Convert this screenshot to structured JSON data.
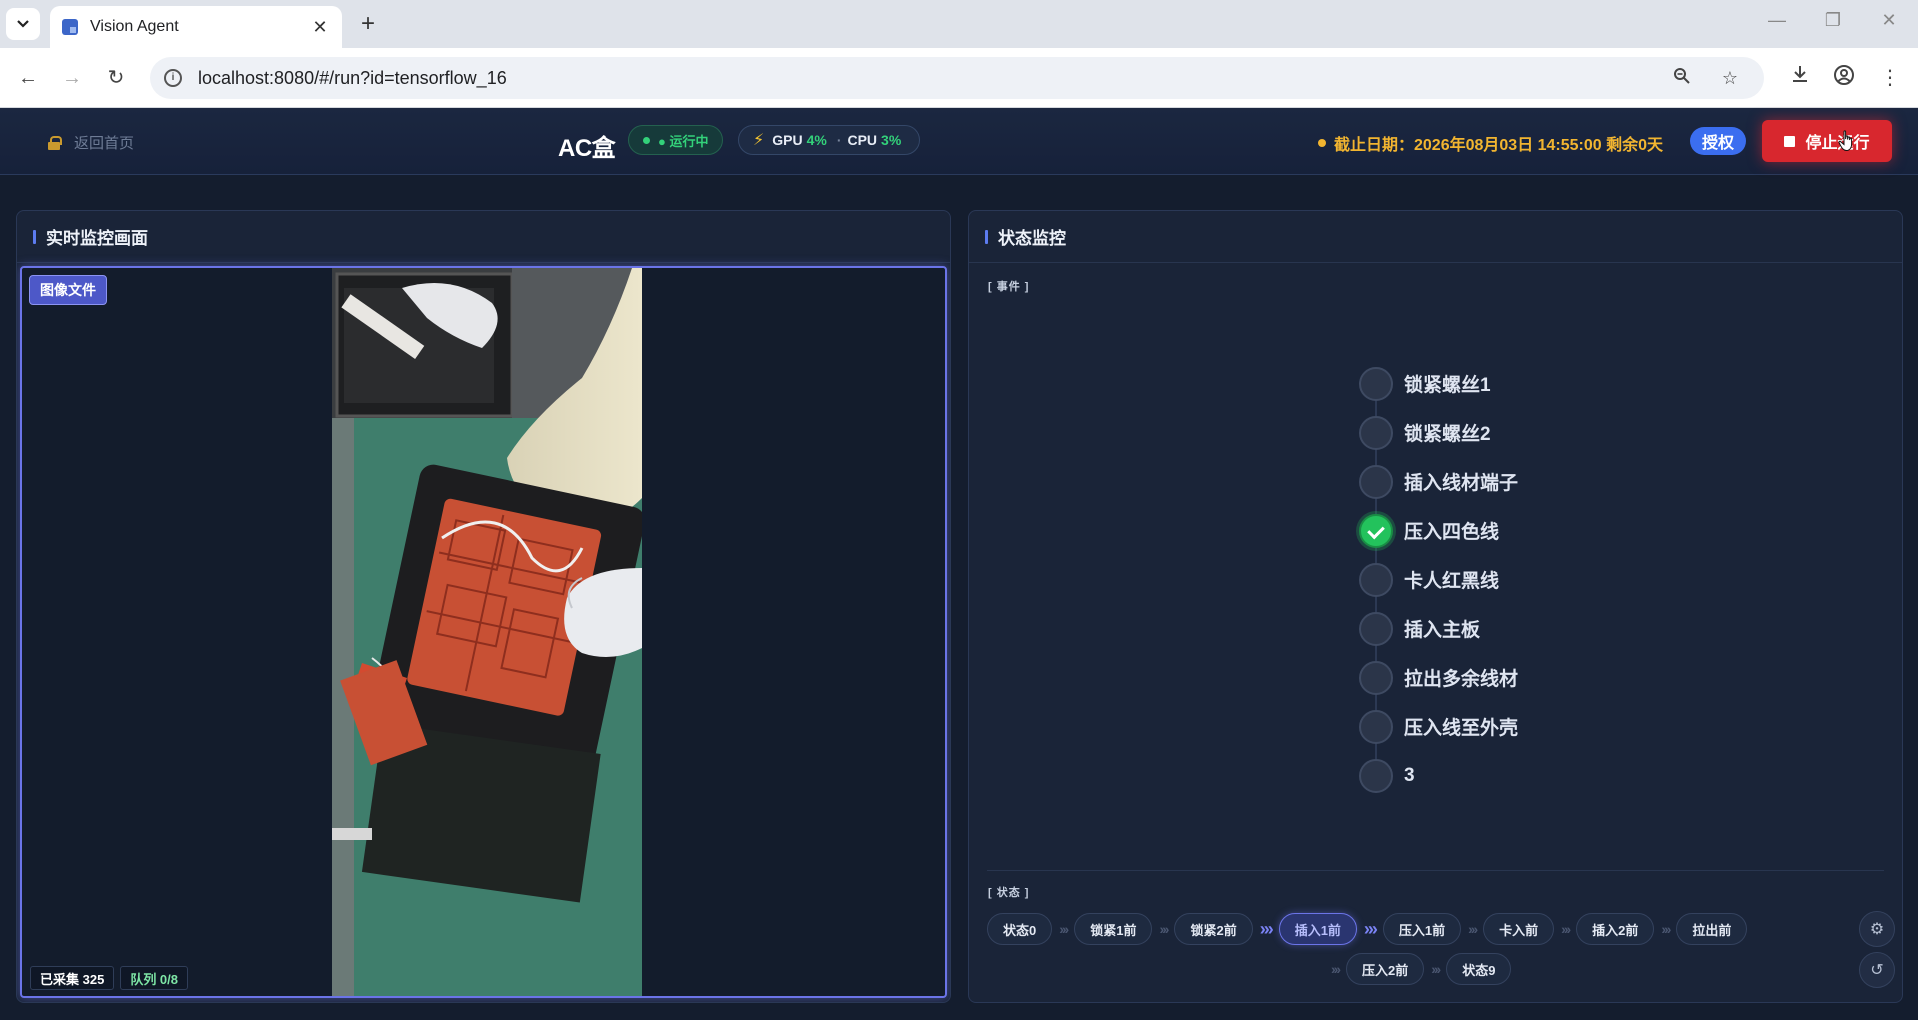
{
  "browser": {
    "tab_title": "Vision Agent",
    "url": "localhost:8080/#/run?id=tensorflow_16"
  },
  "header": {
    "back_label": "返回首页",
    "app_title": "AC盒",
    "run_status": "● 运行中",
    "gpu_label": "GPU",
    "gpu_value": "4%",
    "cpu_label": "CPU",
    "cpu_value": "3%",
    "deadline": "截止日期：2026年08月03日 14:55:00 剩余0天",
    "auth_label": "授权",
    "stop_label": "停止运行"
  },
  "left_panel": {
    "title": "实时监控画面",
    "source_badge": "图像文件",
    "collected": "已采集 325",
    "queue": "队列 0/8"
  },
  "right_panel": {
    "title": "状态监控",
    "events_tag": "[ 事件 ]",
    "states_tag": "[ 状态 ]",
    "events": [
      {
        "label": "锁紧螺丝1",
        "done": false
      },
      {
        "label": "锁紧螺丝2",
        "done": false
      },
      {
        "label": "插入线材端子",
        "done": false
      },
      {
        "label": "压入四色线",
        "done": true
      },
      {
        "label": "卡人红黑线",
        "done": false
      },
      {
        "label": "插入主板",
        "done": false
      },
      {
        "label": "拉出多余线材",
        "done": false
      },
      {
        "label": "压入线至外壳",
        "done": false
      },
      {
        "label": "3",
        "done": false
      }
    ],
    "states_row1": [
      "状态0",
      "锁紧1前",
      "锁紧2前",
      "插入1前",
      "压入1前",
      "卡入前",
      "插入2前",
      "拉出前"
    ],
    "states_row2": [
      "压入2前",
      "状态9"
    ],
    "active_state": "插入1前"
  },
  "colors": {
    "accent": "#6b74e8",
    "running": "#33d17a",
    "warning": "#f2b530",
    "danger": "#d8272e",
    "auth": "#3b6ef0"
  },
  "icons": [
    "chevron-down-icon",
    "close-icon",
    "plus-icon",
    "back-icon",
    "forward-icon",
    "reload-icon",
    "info-icon",
    "zoom-icon",
    "star-icon",
    "download-icon",
    "profile-icon",
    "more-icon",
    "lock-icon",
    "bolt-icon",
    "stop-icon",
    "check-icon",
    "gear-icon",
    "history-icon"
  ]
}
